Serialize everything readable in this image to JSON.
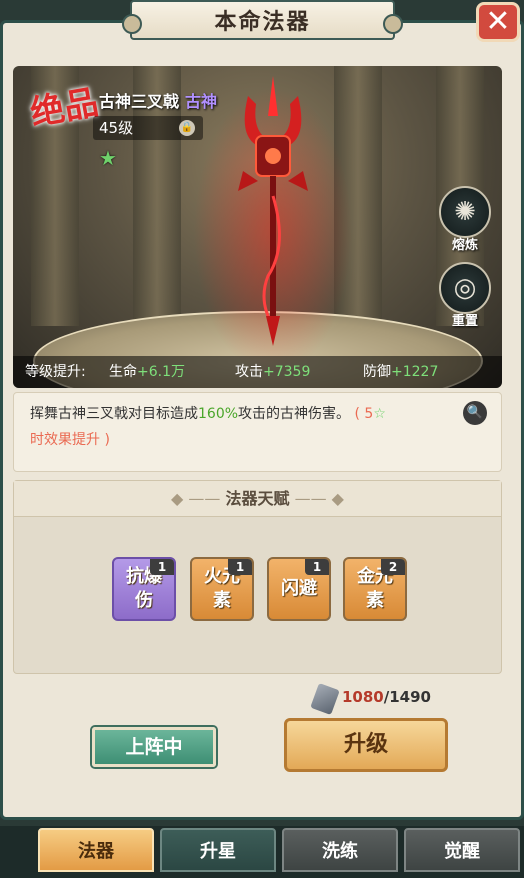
{
  "window": {
    "title": "本命法器",
    "close_label": "✕"
  },
  "weapon": {
    "rarity": "绝品",
    "name": "古神三叉戟",
    "type": "古神",
    "level": "45级",
    "stars": 1
  },
  "side_actions": {
    "smelt": "熔炼",
    "reset": "重置"
  },
  "stats": {
    "label": "等级提升:",
    "hp_label": "生命",
    "hp_value": "+6.1万",
    "atk_label": "攻击",
    "atk_value": "+7359",
    "def_label": "防御",
    "def_value": "+1227"
  },
  "description": {
    "prefix": "挥舞古神三叉戟对目标造成",
    "percent": "160%",
    "suffix": "攻击的古神伤害。",
    "bonus_open": "( 5",
    "bonus_close": "时效果提升 )"
  },
  "talents": {
    "header": "法器天赋",
    "items": [
      {
        "label": "抗爆伤",
        "count": "1",
        "style": "purple"
      },
      {
        "label": "火元素",
        "count": "1",
        "style": "orange"
      },
      {
        "label": "闪避",
        "count": "1",
        "style": "orange"
      },
      {
        "label": "金元素",
        "count": "2",
        "style": "orange"
      }
    ]
  },
  "resource": {
    "have": "1080",
    "need": "/1490"
  },
  "buttons": {
    "deployed": "上阵中",
    "upgrade": "升级"
  },
  "tabs": [
    "法器",
    "升星",
    "洗练",
    "觉醒"
  ],
  "colors": {
    "accent_green": "#4aa62a",
    "rarity_red": "#e02a2a",
    "upgrade_gold": "#e3a957"
  }
}
